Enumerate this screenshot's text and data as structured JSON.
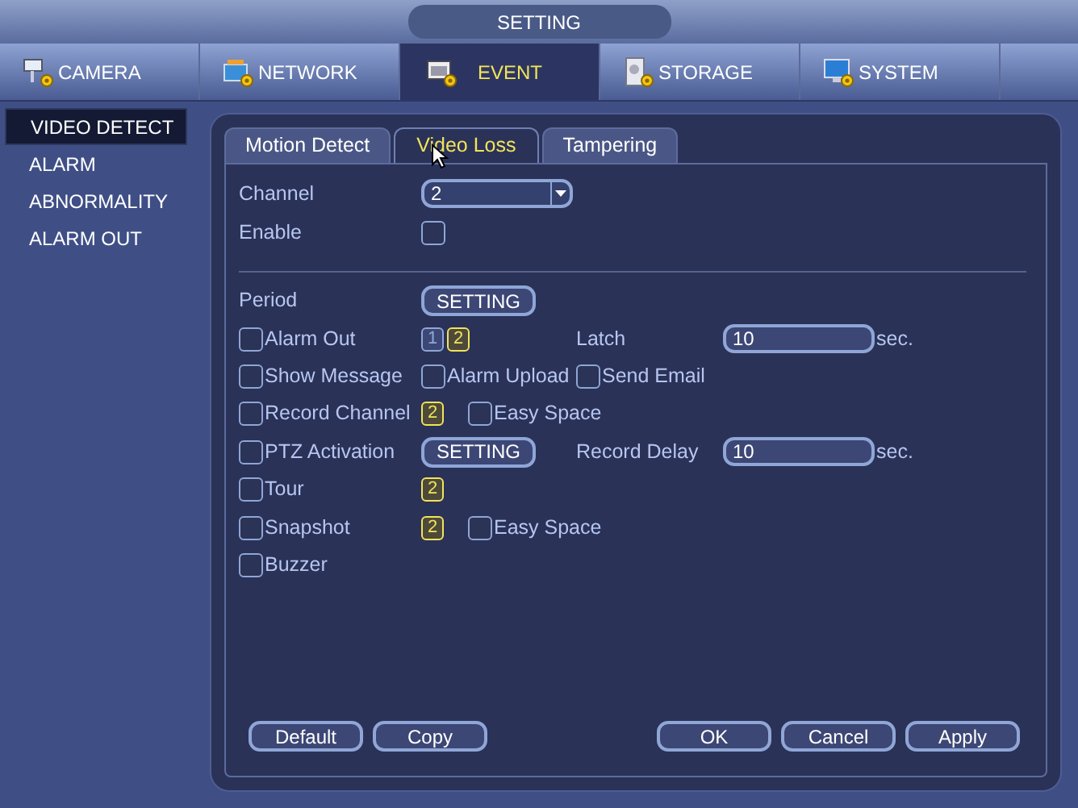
{
  "title": "SETTING",
  "tabs": [
    {
      "label": "CAMERA",
      "kind": "camera",
      "selected": false
    },
    {
      "label": "NETWORK",
      "kind": "network",
      "selected": false
    },
    {
      "label": "EVENT",
      "kind": "event",
      "selected": true
    },
    {
      "label": "STORAGE",
      "kind": "storage",
      "selected": false
    },
    {
      "label": "SYSTEM",
      "kind": "system",
      "selected": false
    }
  ],
  "sidebar": {
    "items": [
      {
        "label": "VIDEO DETECT",
        "selected": true
      },
      {
        "label": "ALARM",
        "selected": false
      },
      {
        "label": "ABNORMALITY",
        "selected": false
      },
      {
        "label": "ALARM OUT",
        "selected": false
      }
    ]
  },
  "subtabs": [
    {
      "label": "Motion Detect",
      "selected": false
    },
    {
      "label": "Video Loss",
      "selected": true
    },
    {
      "label": "Tampering",
      "selected": false
    }
  ],
  "top_rows": [
    {
      "columns": [
        [
          {
            "kind": "label",
            "text": "Channel"
          }
        ],
        [
          {
            "kind": "dropdown",
            "value": "2"
          }
        ]
      ]
    },
    {
      "columns": [
        [
          {
            "kind": "label",
            "text": "Enable"
          }
        ],
        [
          {
            "kind": "checkbox",
            "checked": false
          }
        ]
      ]
    }
  ],
  "rows": [
    {
      "columns": [
        [
          {
            "kind": "label",
            "text": "Period"
          }
        ],
        [
          {
            "kind": "button",
            "text": "SETTING"
          }
        ]
      ]
    },
    {
      "columns": [
        [
          {
            "kind": "checkbox",
            "text": "Alarm Out",
            "checked": false
          }
        ],
        [
          {
            "kind": "badges",
            "items": [
              {
                "label": "1",
                "selected": false
              },
              {
                "label": "2",
                "selected": true
              }
            ]
          }
        ],
        [
          {
            "kind": "label",
            "text": "Latch"
          }
        ],
        [
          {
            "kind": "field",
            "value": "10",
            "unit": "sec."
          }
        ]
      ]
    },
    {
      "columns": [
        [
          {
            "kind": "checkbox",
            "text": "Show Message",
            "checked": false
          }
        ],
        [
          {
            "kind": "checkbox",
            "text": "Alarm Upload",
            "checked": false
          }
        ],
        [
          {
            "kind": "checkbox",
            "text": "Send Email",
            "checked": false
          }
        ]
      ]
    },
    {
      "columns": [
        [
          {
            "kind": "checkbox",
            "text": "Record Channel",
            "checked": false
          }
        ],
        [
          {
            "kind": "badges",
            "items": [
              {
                "label": "2",
                "selected": true
              }
            ]
          },
          {
            "kind": "checkbox",
            "text": "Easy Space",
            "checked": false
          }
        ]
      ]
    },
    {
      "columns": [
        [
          {
            "kind": "checkbox",
            "text": "PTZ Activation",
            "checked": false
          }
        ],
        [
          {
            "kind": "button",
            "text": "SETTING"
          }
        ],
        [
          {
            "kind": "label",
            "text": "Record Delay"
          }
        ],
        [
          {
            "kind": "field",
            "value": "10",
            "unit": "sec."
          }
        ]
      ]
    },
    {
      "columns": [
        [
          {
            "kind": "checkbox",
            "text": "Tour",
            "checked": false
          }
        ],
        [
          {
            "kind": "badges",
            "items": [
              {
                "label": "2",
                "selected": true
              }
            ]
          }
        ]
      ]
    },
    {
      "columns": [
        [
          {
            "kind": "checkbox",
            "text": "Snapshot",
            "checked": false
          }
        ],
        [
          {
            "kind": "badges",
            "items": [
              {
                "label": "2",
                "selected": true
              }
            ]
          },
          {
            "kind": "checkbox",
            "text": "Easy Space",
            "checked": false
          }
        ]
      ]
    },
    {
      "columns": [
        [
          {
            "kind": "checkbox",
            "text": "Buzzer",
            "checked": false
          }
        ]
      ]
    }
  ],
  "buttons_left": [
    "Default",
    "Copy"
  ],
  "buttons_right": [
    "OK",
    "Cancel",
    "Apply"
  ]
}
